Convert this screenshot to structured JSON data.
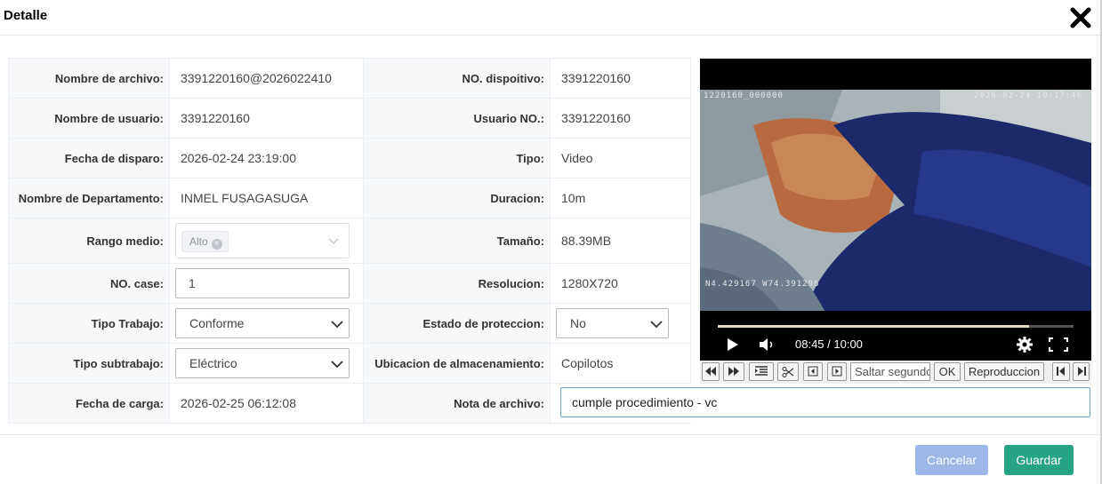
{
  "dialog": {
    "title": "Detalle",
    "cancel_label": "Cancelar",
    "save_label": "Guardar"
  },
  "fields": {
    "nombre_archivo": {
      "label": "Nombre de archivo:",
      "value": "3391220160@2026022410"
    },
    "no_dispositivo": {
      "label": "NO. dispoitivo:",
      "value": "3391220160"
    },
    "nombre_usuario": {
      "label": "Nombre de usuario:",
      "value": "3391220160"
    },
    "usuario_no": {
      "label": "Usuario NO.:",
      "value": "3391220160"
    },
    "fecha_disparo": {
      "label": "Fecha de disparo:",
      "value": "2026-02-24 23:19:00"
    },
    "tipo": {
      "label": "Tipo:",
      "value": "Video"
    },
    "departamento": {
      "label": "Nombre de Departamento:",
      "value": "INMEL FUSAGASUGA"
    },
    "duracion": {
      "label": "Duracion:",
      "value": "10m"
    },
    "rango_medio": {
      "label": "Rango medio:",
      "tag": "Alto"
    },
    "tamano": {
      "label": "Tamaño:",
      "value": "88.39MB"
    },
    "no_case": {
      "label": "NO. case:",
      "value": "1"
    },
    "resolucion": {
      "label": "Resolucion:",
      "value": "1280X720"
    },
    "tipo_trabajo": {
      "label": "Tipo Trabajo:",
      "value": "Conforme"
    },
    "estado_proteccion": {
      "label": "Estado de proteccion:",
      "value": "No"
    },
    "tipo_subtrabajo": {
      "label": "Tipo subtrabajo:",
      "value": "Eléctrico"
    },
    "ubicacion": {
      "label": "Ubicacion de almacenamiento:",
      "value": "Copilotos"
    },
    "fecha_carga": {
      "label": "Fecha de carga:",
      "value": "2026-02-25 06:12:08"
    },
    "nota_archivo": {
      "label": "Nota de archivo:",
      "value": "cumple procedimiento - vc"
    }
  },
  "video": {
    "osd_id": "1220160_000000",
    "osd_datetime": "2026-02-24 10:17:46",
    "osd_coords": "N4.429167 W74.391296",
    "timecode": "08:45 / 10:00",
    "progress": 0.875
  },
  "player_toolbar": {
    "seek_placeholder": "Saltar segundo",
    "ok_label": "OK",
    "playback_label": "Reproduccion"
  },
  "colors": {
    "cancel": "#9cb8e6",
    "save": "#26a485",
    "note_border": "#6aa4d8"
  }
}
